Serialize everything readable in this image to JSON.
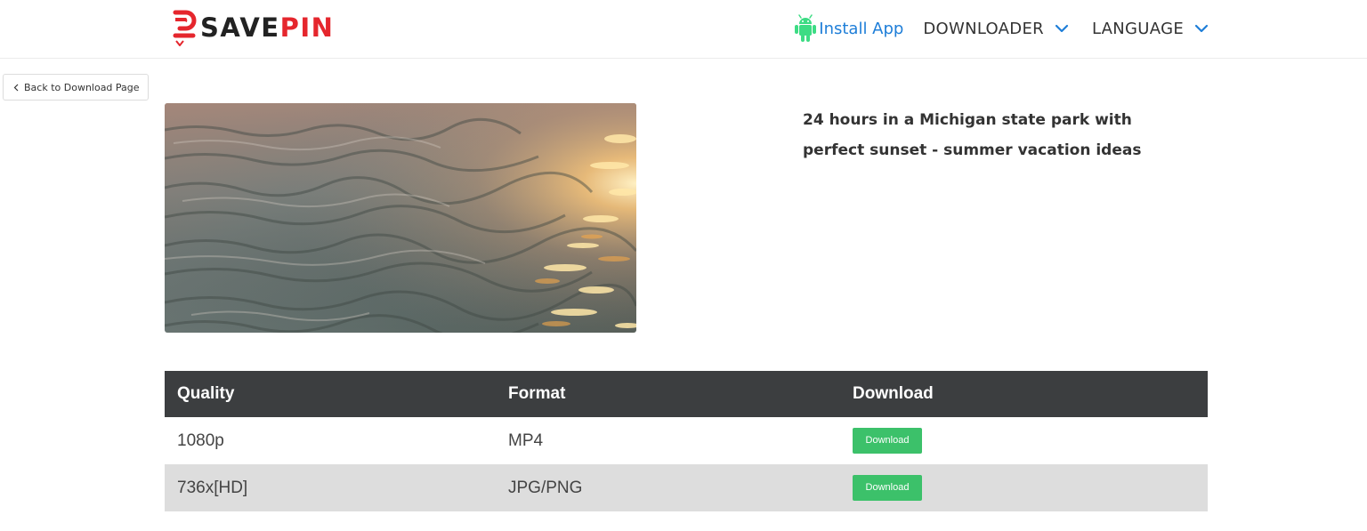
{
  "header": {
    "logo": {
      "part1": "SAVE",
      "part2": "PIN"
    },
    "nav": {
      "install_label": "Install App",
      "install_icon": "android-icon",
      "downloader_label": "DOWNLOADER",
      "language_label": "LANGUAGE",
      "dropdown_icon": "chevron-down-icon"
    }
  },
  "back_button": {
    "label": "Back to Download Page",
    "icon": "chevron-left-icon"
  },
  "media": {
    "title": "24 hours in a Michigan state park with perfect sunset - summer vacation ideas"
  },
  "table": {
    "headers": [
      "Quality",
      "Format",
      "Download"
    ],
    "rows": [
      {
        "quality": "1080p",
        "format": "MP4",
        "action": "Download"
      },
      {
        "quality": "736x[HD]",
        "format": "JPG/PNG",
        "action": "Download"
      }
    ]
  },
  "colors": {
    "brand_red": "#e5262d",
    "link_blue": "#1e7ed8",
    "android_green": "#3ddc84",
    "download_green": "#3cc16a",
    "table_header": "#3c3e40",
    "row_alt": "#dddddd"
  }
}
